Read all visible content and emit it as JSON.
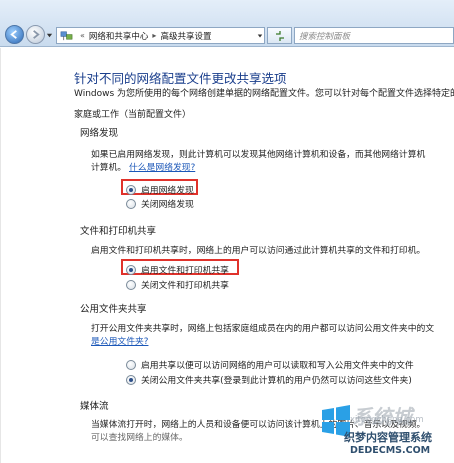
{
  "address_bar": {
    "crumbs": [
      "网络和共享中心",
      "高级共享设置"
    ],
    "search_placeholder": "搜索控制面板"
  },
  "page": {
    "title": "针对不同的网络配置文件更改共享选项",
    "description": "Windows 为您所使用的每个网络创建单据的网络配置文件。您可以针对每个配置文件选择特定的",
    "profile_label": "家庭或工作（当前配置文件）"
  },
  "sections": {
    "network_discovery": {
      "heading": "网络发现",
      "text_line1": "如果已启用网络发现，则此计算机可以发现其他网络计算机和设备，而其他网络计算机",
      "text_line2": "计算机。",
      "link": "什么是网络发现?",
      "options": [
        {
          "label": "启用网络发现",
          "checked": true
        },
        {
          "label": "关闭网络发现",
          "checked": false
        }
      ]
    },
    "file_printer_sharing": {
      "heading": "文件和打印机共享",
      "text": "启用文件和打印机共享时，网络上的用户可以访问通过此计算机共享的文件和打印机。",
      "options": [
        {
          "label": "启用文件和打印机共享",
          "checked": true
        },
        {
          "label": "关闭文件和打印机共享",
          "checked": false
        }
      ]
    },
    "public_folder_sharing": {
      "heading": "公用文件夹共享",
      "text": "打开公用文件夹共享时，网络上包括家庭组成员在内的用户都可以访问公用文件夹中的文",
      "link": "是公用文件夹?",
      "options": [
        {
          "label": "启用共享以便可以访问网络的用户可以读取和写入公用文件夹中的文件",
          "checked": false
        },
        {
          "label": "关闭公用文件夹共享(登录到此计算机的用户仍然可以访问这些文件夹)",
          "checked": true
        }
      ]
    },
    "media_streaming": {
      "heading": "媒体流",
      "text_line1": "当媒体流打开时，网络上的人员和设备便可以访问该计算机上的图片、音乐以及视频。",
      "text_line2": "可以查找网络上的媒体。"
    }
  },
  "watermark": {
    "top": "系统城",
    "url": "xitongcheng.com",
    "mid": "织梦内容管理系统",
    "bottom": "DEDECMS.COM"
  },
  "colors": {
    "title": "#1a3e8c",
    "link": "#1b57b8",
    "highlight": "#e0322b"
  }
}
